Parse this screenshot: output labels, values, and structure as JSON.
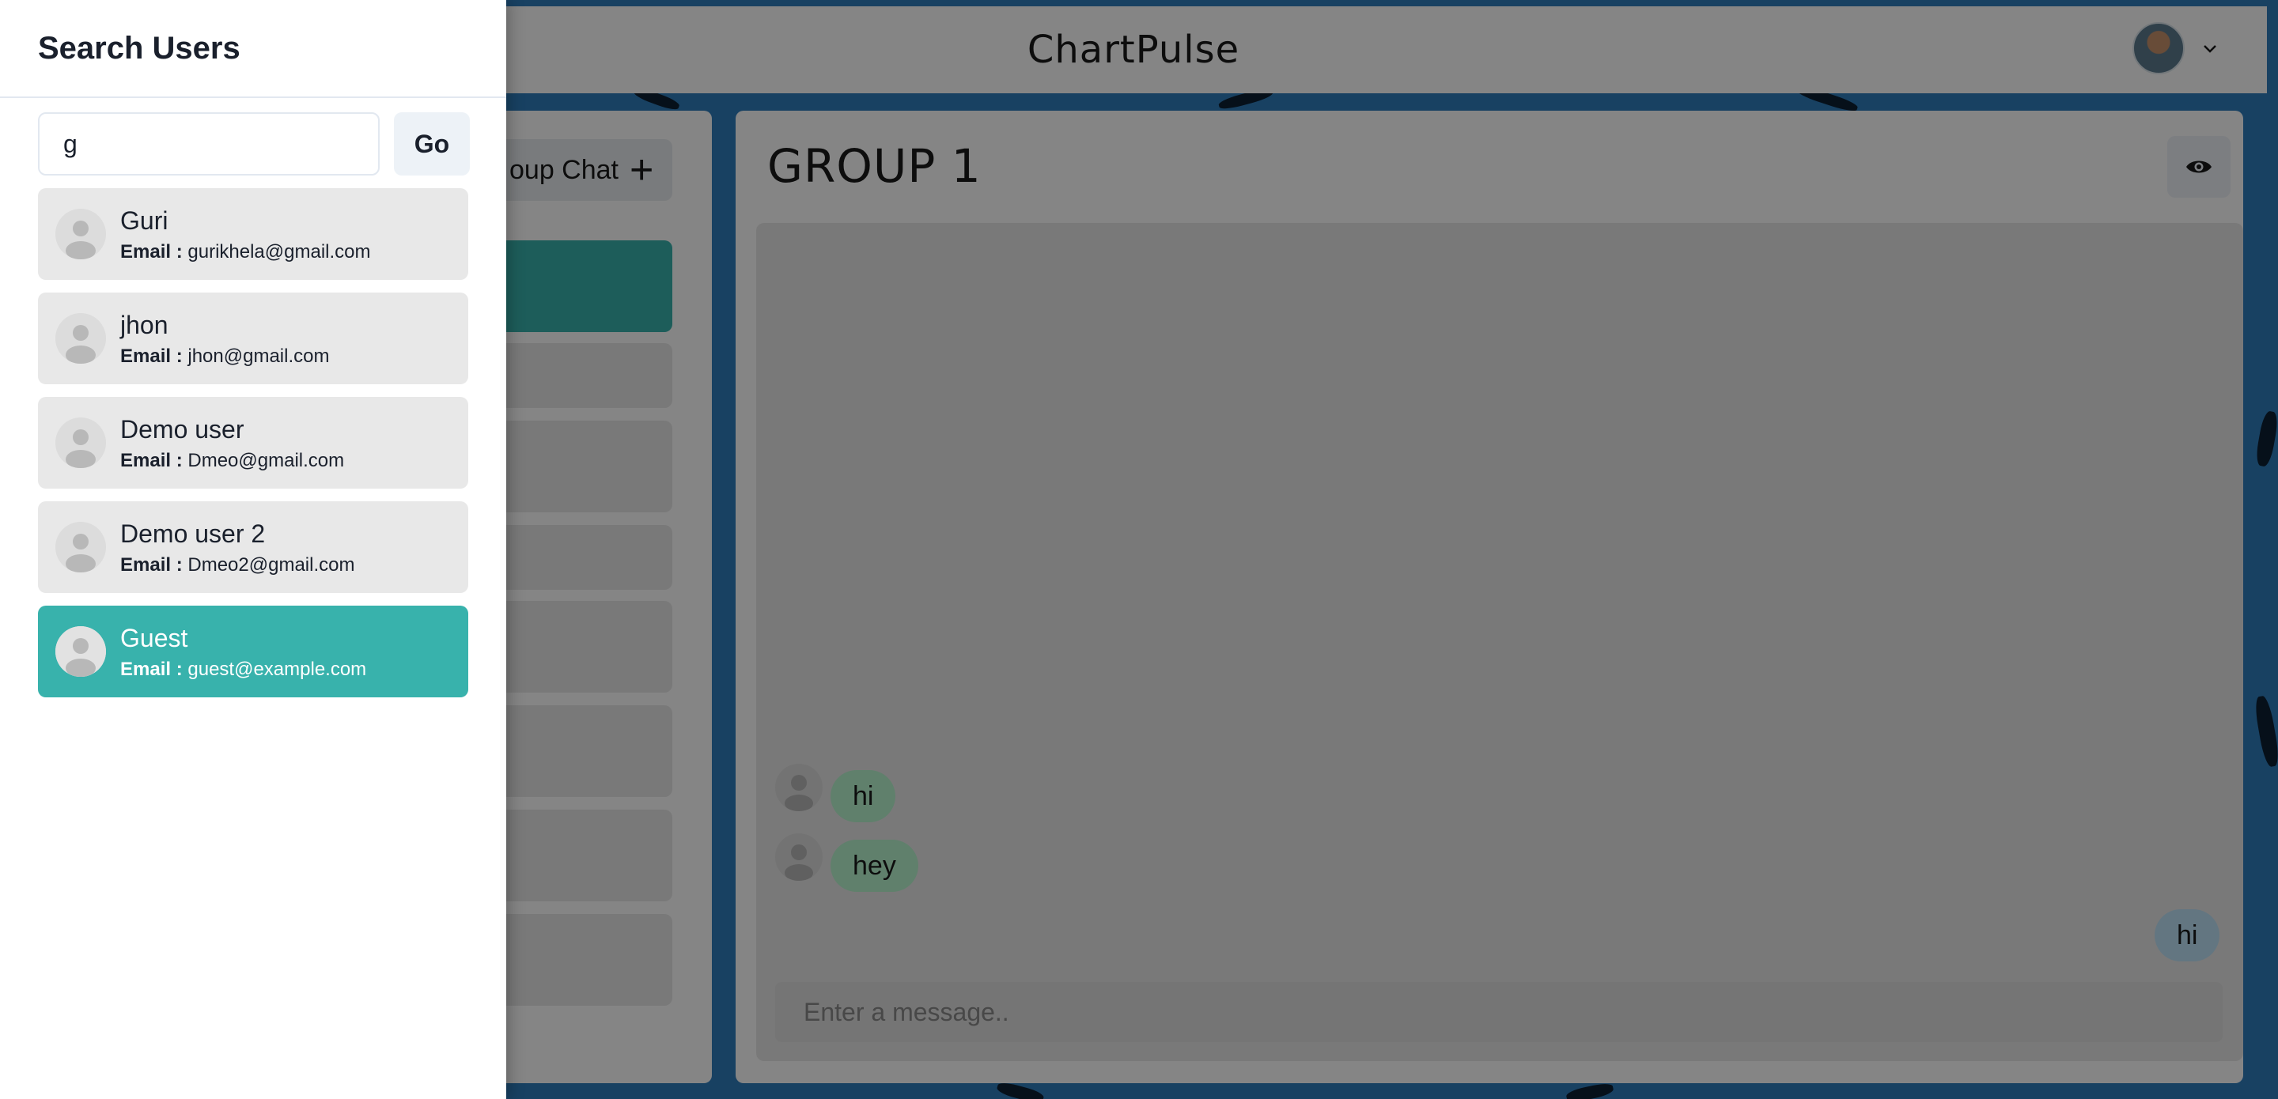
{
  "app": {
    "brand": "ChartPulse",
    "new_group_label": "oup Chat",
    "plus_symbol": "+"
  },
  "chat": {
    "title": "GROUP 1",
    "messages": [
      {
        "text": "hi",
        "sender": "them"
      },
      {
        "text": "hey",
        "sender": "them"
      },
      {
        "text": "hi",
        "sender": "me"
      }
    ],
    "input_placeholder": "Enter a message.."
  },
  "drawer": {
    "title": "Search Users",
    "search_value": "g",
    "go_label": "Go",
    "email_label": "Email :",
    "users": [
      {
        "name": "Guri",
        "email": "gurikhela@gmail.com"
      },
      {
        "name": "jhon",
        "email": "jhon@gmail.com"
      },
      {
        "name": "Demo user",
        "email": "Dmeo@gmail.com"
      },
      {
        "name": "Demo user 2",
        "email": "Dmeo2@gmail.com"
      },
      {
        "name": "Guest",
        "email": "guest@example.com"
      }
    ]
  },
  "colors": {
    "accent": "#38b2ac",
    "bubble_them": "#b9f5d0",
    "bubble_me": "#bee3f8",
    "background": "#2f7dbd"
  }
}
